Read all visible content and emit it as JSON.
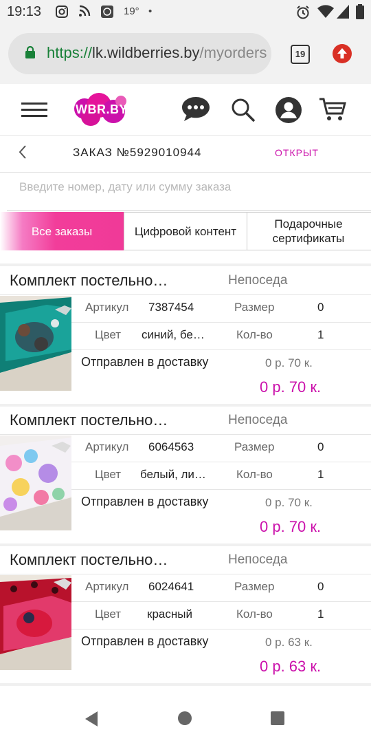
{
  "status_bar": {
    "time": "19:13",
    "temperature": "19°",
    "dot": "•",
    "icons": [
      "instagram-icon",
      "rss-icon",
      "app-icon",
      "alarm-icon",
      "wifi-icon",
      "signal-icon",
      "battery-icon"
    ]
  },
  "browser": {
    "url_scheme": "https://",
    "url_host": "lk.wildberries.by",
    "url_path": "/myorders",
    "tab_count": "19",
    "update_color": "#d93025"
  },
  "header": {
    "logo_text": "WBR.BY",
    "icons": [
      "menu-icon",
      "chat-icon",
      "search-icon",
      "account-icon",
      "cart-icon"
    ]
  },
  "order": {
    "title": "ЗАКАЗ №5929010944",
    "status": "ОТКРЫТ"
  },
  "search": {
    "placeholder": "Введите номер, дату или сумму заказа"
  },
  "tabs": {
    "all": "Все заказы",
    "digital": "Цифровой контент",
    "gift_line1": "Подарочные",
    "gift_line2": "сертификаты"
  },
  "labels": {
    "article": "Артикул",
    "size": "Размер",
    "color": "Цвет",
    "qty": "Кол-во"
  },
  "items": [
    {
      "name": "Комплект постельно…",
      "brand": "Непоседа",
      "article": "7387454",
      "size": "0",
      "color": "синий, бе…",
      "qty": "1",
      "status": "Отправлен в доставку",
      "price": "0 р. 70 к.",
      "total": "0 р. 70 к."
    },
    {
      "name": "Комплект постельно…",
      "brand": "Непоседа",
      "article": "6064563",
      "size": "0",
      "color": "белый, ли…",
      "qty": "1",
      "status": "Отправлен в доставку",
      "price": "0 р. 70 к.",
      "total": "0 р. 70 к."
    },
    {
      "name": "Комплект постельно…",
      "brand": "Непоседа",
      "article": "6024641",
      "size": "0",
      "color": "красный",
      "qty": "1",
      "status": "Отправлен в доставку",
      "price": "0 р. 63 к.",
      "total": "0 р. 63 к."
    }
  ],
  "colors": {
    "accent": "#cb11ab",
    "tab_gradient": "#f03a98",
    "https_green": "#188038"
  }
}
